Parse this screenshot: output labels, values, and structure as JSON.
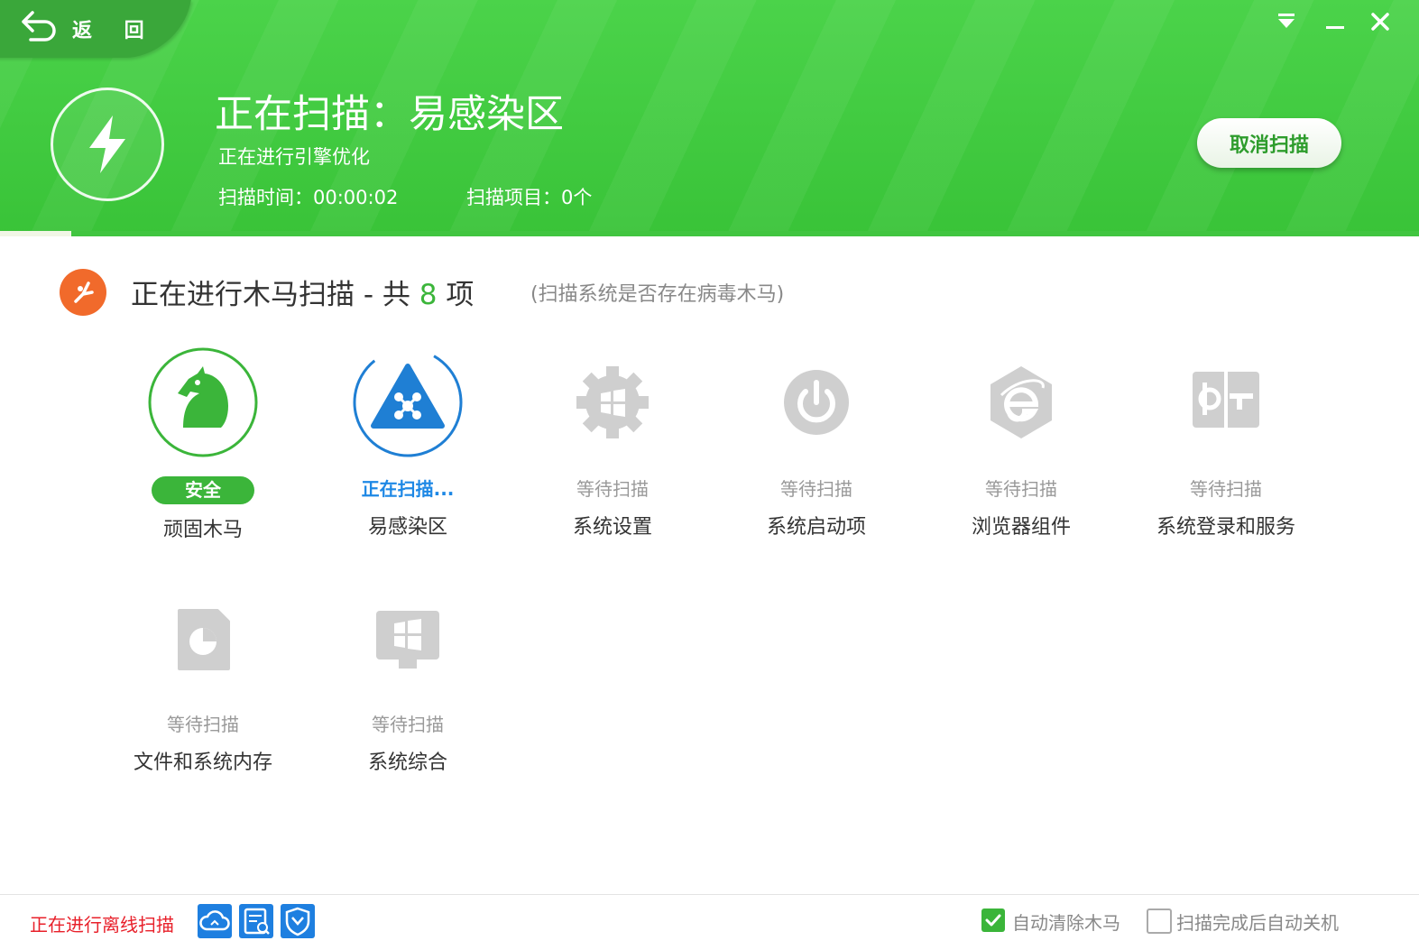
{
  "header": {
    "back_label": "返 回",
    "title": "正在扫描：易感染区",
    "subtitle": "正在进行引擎优化",
    "scan_time": "扫描时间：00:00:02",
    "scan_items": "扫描项目：0个",
    "cancel_label": "取消扫描",
    "progress": 0.05,
    "colors": {
      "green": "#3cc83b",
      "accent": "#3bb53a"
    },
    "icons": [
      "back-arrow-icon",
      "menu-dropdown-icon",
      "minimize-icon",
      "close-icon",
      "lightning-icon"
    ]
  },
  "section": {
    "title_prefix": "正在进行木马扫描 - 共 ",
    "count": "8",
    "title_suffix": " 项",
    "note": "(扫描系统是否存在病毒木马)",
    "icon": "trojan-scan-icon"
  },
  "items": [
    {
      "status": "安全",
      "name": "顽固木马",
      "state": "safe",
      "icon": "horse-icon"
    },
    {
      "status": "正在扫描...",
      "name": "易感染区",
      "state": "scanning",
      "icon": "network-triangle-icon"
    },
    {
      "status": "等待扫描",
      "name": "系统设置",
      "state": "waiting",
      "icon": "windows-gear-icon"
    },
    {
      "status": "等待扫描",
      "name": "系统启动项",
      "state": "waiting",
      "icon": "power-icon"
    },
    {
      "status": "等待扫描",
      "name": "浏览器组件",
      "state": "waiting",
      "icon": "ie-browser-icon"
    },
    {
      "status": "等待扫描",
      "name": "系统登录和服务",
      "state": "waiting",
      "icon": "login-service-icon"
    },
    {
      "status": "等待扫描",
      "name": "文件和系统内存",
      "state": "waiting",
      "icon": "file-memory-icon"
    },
    {
      "status": "等待扫描",
      "name": "系统综合",
      "state": "waiting",
      "icon": "windows-monitor-icon"
    }
  ],
  "footer": {
    "status": "正在进行离线扫描",
    "icons": [
      "cloud-engine-icon",
      "local-engine-icon",
      "shield-engine-icon"
    ],
    "auto_clean_label": "自动清除木马",
    "auto_clean_checked": true,
    "auto_shutdown_label": "扫描完成后自动关机",
    "auto_shutdown_checked": false
  }
}
